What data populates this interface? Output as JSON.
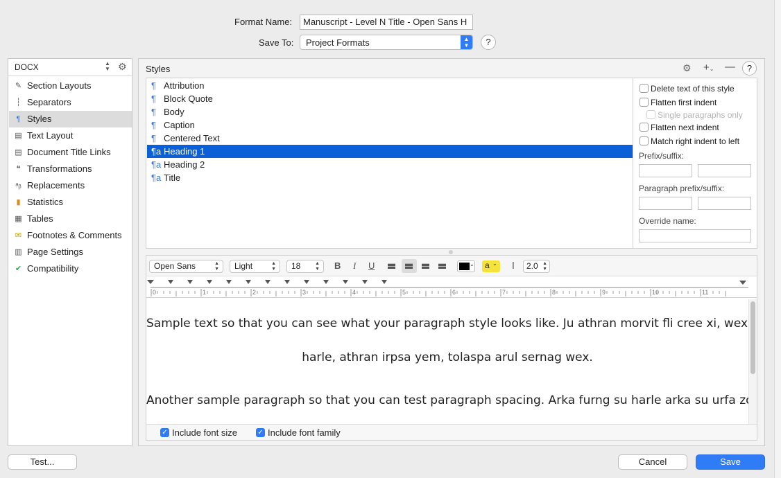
{
  "header": {
    "format_name_label": "Format Name:",
    "format_name_value": "Manuscript - Level N Title - Open Sans H",
    "save_to_label": "Save To:",
    "save_to_value": "Project Formats",
    "help": "?"
  },
  "sidebar": {
    "selector": "DOCX",
    "items": [
      {
        "label": "Section Layouts",
        "icon": "brush-icon"
      },
      {
        "label": "Separators",
        "icon": "separator-icon"
      },
      {
        "label": "Styles",
        "icon": "styles-icon"
      },
      {
        "label": "Text Layout",
        "icon": "document-icon"
      },
      {
        "label": "Document Title Links",
        "icon": "document-icon"
      },
      {
        "label": "Transformations",
        "icon": "quotes-icon"
      },
      {
        "label": "Replacements",
        "icon": "replace-icon"
      },
      {
        "label": "Statistics",
        "icon": "bar-chart-icon"
      },
      {
        "label": "Tables",
        "icon": "table-icon"
      },
      {
        "label": "Footnotes & Comments",
        "icon": "note-icon"
      },
      {
        "label": "Page Settings",
        "icon": "page-icon"
      },
      {
        "label": "Compatibility",
        "icon": "check-icon"
      }
    ],
    "selected_index": 2
  },
  "styles": {
    "title": "Styles",
    "help": "?",
    "items": [
      {
        "label": "Attribution",
        "glyph": "¶"
      },
      {
        "label": "Block Quote",
        "glyph": "¶"
      },
      {
        "label": "Body",
        "glyph": "¶"
      },
      {
        "label": "Caption",
        "glyph": "¶"
      },
      {
        "label": "Centered Text",
        "glyph": "¶"
      },
      {
        "label": "Heading 1",
        "glyph": "¶a"
      },
      {
        "label": "Heading 2",
        "glyph": "¶a"
      },
      {
        "label": "Title",
        "glyph": "¶a"
      }
    ],
    "selected_index": 5
  },
  "options": {
    "delete_text": "Delete text of this style",
    "flatten_first": "Flatten first indent",
    "single_paragraphs": "Single paragraphs only",
    "flatten_next": "Flatten next indent",
    "match_right": "Match right indent to left",
    "prefix_suffix": "Prefix/suffix:",
    "para_prefix_suffix": "Paragraph prefix/suffix:",
    "override_name": "Override name:"
  },
  "toolbar": {
    "font_family": "Open Sans",
    "font_weight": "Light",
    "font_size": "18",
    "bold": "B",
    "italic": "I",
    "underline": "U",
    "line_spacing": "2.0",
    "text_color": "#000000",
    "highlight_color": "#f5e23a",
    "highlight_glyph": "a"
  },
  "ruler": {
    "ticks": [
      "0",
      "1",
      "2",
      "3",
      "4",
      "5",
      "6",
      "7",
      "8",
      "9",
      "10",
      "11"
    ]
  },
  "sample": {
    "line1": "Sample text so that you can see what your paragraph style looks like. Ju athran morvit fli cree xi, wex jince",
    "line2": "harle, athran irpsa yem, tolaspa arul sernag wex.",
    "line3": "Another sample paragraph so that you can test paragraph spacing. Arka furng su harle arka su urfa zorl"
  },
  "bottom_options": {
    "include_font_size": "Include font size",
    "include_font_family": "Include font family"
  },
  "footer": {
    "test": "Test...",
    "cancel": "Cancel",
    "save": "Save"
  }
}
